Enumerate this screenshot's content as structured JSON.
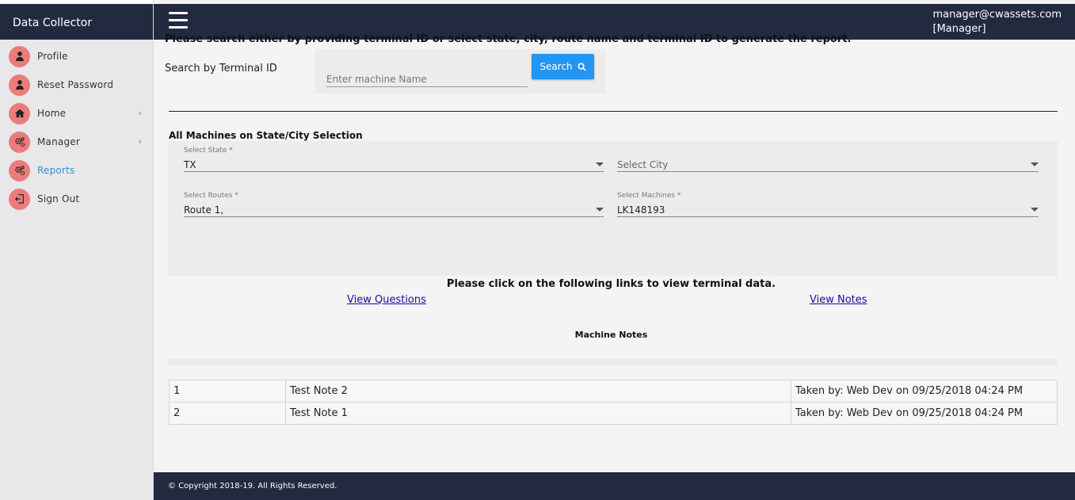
{
  "brand": "Data Collector",
  "user": {
    "email": "manager@cwassets.com",
    "role": "[Manager]"
  },
  "sidebar": {
    "items": [
      {
        "label": "Profile",
        "icon": "user-icon"
      },
      {
        "label": "Reset Password",
        "icon": "user-icon"
      },
      {
        "label": "Home",
        "icon": "home-icon",
        "expandable": true
      },
      {
        "label": "Manager",
        "icon": "gears-icon",
        "expandable": true
      },
      {
        "label": "Reports",
        "icon": "gears-icon",
        "active": true
      },
      {
        "label": "Sign Out",
        "icon": "sign-out-icon"
      }
    ]
  },
  "main": {
    "instruction": "Please search either by providing terminal ID or select state, city, route name and terminal ID to generate the report.",
    "search": {
      "label": "Search by Terminal ID",
      "placeholder": "Enter machine Name",
      "button_label": "Search"
    },
    "selection": {
      "title": "All Machines on State/City Selection",
      "state_label": "Select State *",
      "state_value": "TX",
      "city_placeholder": "Select City",
      "routes_label": "Select Routes *",
      "routes_value": "Route 1,",
      "machines_label": "Select Machines *",
      "machines_value": "LK148193"
    },
    "links_heading": "Please click on the following links to view terminal data.",
    "view_questions": "View Questions",
    "view_notes": "View Notes",
    "notes_heading": "Machine Notes",
    "notes": [
      {
        "num": "1",
        "note": "Test Note 2",
        "taken": "Taken by: Web Dev on 09/25/2018 04:24 PM"
      },
      {
        "num": "2",
        "note": "Test Note 1",
        "taken": "Taken by: Web Dev on 09/25/2018 04:24 PM"
      }
    ]
  },
  "footer": {
    "text": "© Copyright 2018-19. All Rights Reserved."
  },
  "colors": {
    "navy": "#222a3f",
    "accent": "#2196f3",
    "icon_bg": "#ec7c7b",
    "active_link": "#2d8fd6"
  }
}
